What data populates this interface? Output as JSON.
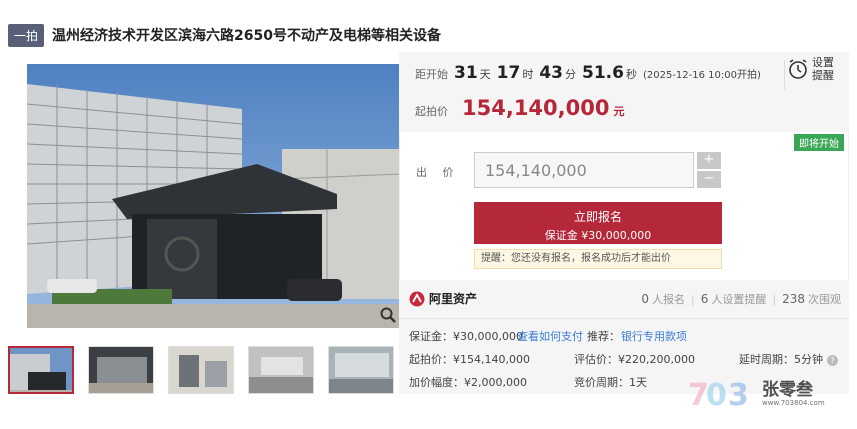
{
  "title": {
    "round_badge": "一拍",
    "text": "温州经济技术开发区滨海六路2650号不动产及电梯等相关设备"
  },
  "countdown": {
    "label": "距开始",
    "days": "31",
    "days_unit": "天",
    "hours": "17",
    "hours_unit": "时",
    "minutes": "43",
    "minutes_unit": "分",
    "seconds": "51.6",
    "seconds_unit": "秒",
    "start_note": "(2025-12-16 10:00开拍)"
  },
  "starting_price": {
    "label": "起拍价",
    "value": "154,140,000",
    "unit": "元"
  },
  "reminder": {
    "label": "设置提醒",
    "icon": "alarm-clock-icon"
  },
  "status_badge": "即将开始",
  "bid": {
    "label": "出 价",
    "value": "154,140,000",
    "plus": "+",
    "minus": "−"
  },
  "register": {
    "label": "立即报名",
    "deposit": "保证金 ¥30,000,000"
  },
  "notice": "提醒：您还没有报名，报名成功后才能出价",
  "platform": {
    "name": "阿里资产"
  },
  "stats": [
    {
      "num": "0",
      "label": "人报名"
    },
    {
      "num": "6",
      "label": "人设置提醒"
    },
    {
      "num": "238",
      "label": "次围观"
    }
  ],
  "details": {
    "deposit_label": "保证金：¥30,000,000",
    "deposit_link": "查看如何支付",
    "recommend_label": "推荐：",
    "recommend_link": "银行专用款项",
    "start_price": "起拍价：¥154,140,000",
    "appraisal": "评估价：¥220,200,000",
    "delay": "延时周期：5分钟",
    "increment": "加价幅度：¥2,000,000",
    "cycle": "竞价周期：1天"
  },
  "watermark": {
    "name": "张零叁",
    "url": "www.703804.com"
  },
  "colors": {
    "accent": "#b5283a",
    "green": "#3aa757",
    "link": "#3a7bd5"
  }
}
